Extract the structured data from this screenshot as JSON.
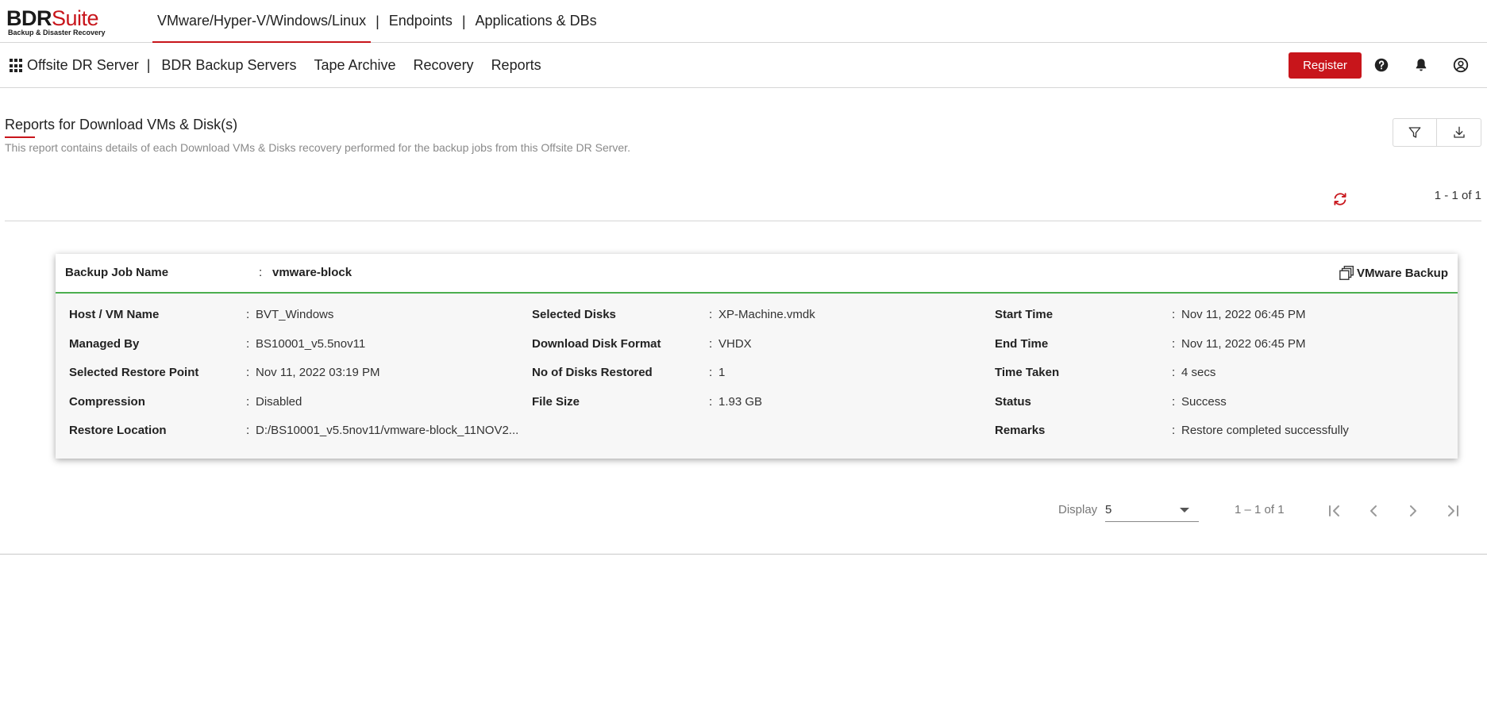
{
  "logo": {
    "brand_dark": "BDR",
    "brand_red": "Suite",
    "tagline": "Backup & Disaster Recovery"
  },
  "product_tabs": [
    {
      "label": "VMware/Hyper-V/Windows/Linux",
      "active": true
    },
    {
      "label": "Endpoints",
      "active": false
    },
    {
      "label": "Applications & DBs",
      "active": false
    }
  ],
  "separator": "|",
  "secondary_nav": {
    "home": "Offsite DR Server",
    "items": [
      "BDR Backup Servers",
      "Tape Archive",
      "Recovery",
      "Reports"
    ],
    "register_label": "Register"
  },
  "page": {
    "title": "Reports for Download VMs & Disk(s)",
    "description": "This report contains details of each Download VMs & Disks recovery performed for the backup jobs from this Offsite DR Server.",
    "top_count": "1 - 1 of 1"
  },
  "card": {
    "job_label": "Backup Job Name",
    "job_value": "vmware-block",
    "job_type": "VMware Backup",
    "colon": ":",
    "columns": [
      [
        {
          "k": "Host / VM Name",
          "v": "BVT_Windows"
        },
        {
          "k": "Managed By",
          "v": "BS10001_v5.5nov11"
        },
        {
          "k": "Selected Restore Point",
          "v": "Nov 11, 2022 03:19 PM"
        },
        {
          "k": "Compression",
          "v": "Disabled"
        },
        {
          "k": "Restore Location",
          "v": "D:/BS10001_v5.5nov11/vmware-block_11NOV2..."
        }
      ],
      [
        {
          "k": "Selected Disks",
          "v": "XP-Machine.vmdk"
        },
        {
          "k": "Download Disk Format",
          "v": "VHDX"
        },
        {
          "k": "No of Disks Restored",
          "v": "1"
        },
        {
          "k": "File Size",
          "v": "1.93 GB"
        }
      ],
      [
        {
          "k": "Start Time",
          "v": "Nov 11, 2022 06:45 PM"
        },
        {
          "k": "End Time",
          "v": "Nov 11, 2022 06:45 PM"
        },
        {
          "k": "Time Taken",
          "v": "4 secs"
        },
        {
          "k": "Status",
          "v": "Success"
        },
        {
          "k": "Remarks",
          "v": "Restore completed successfully"
        }
      ]
    ]
  },
  "paginator": {
    "display_label": "Display",
    "page_size": "5",
    "range": "1 – 1 of 1"
  },
  "colors": {
    "accent": "#c8151b",
    "success_line": "#4caf50"
  },
  "icons": [
    "apps-grid-icon",
    "help-icon",
    "bell-icon",
    "account-icon",
    "filter-icon",
    "download-icon",
    "refresh-icon",
    "vmware-icon",
    "first-page-icon",
    "prev-page-icon",
    "next-page-icon",
    "last-page-icon"
  ]
}
